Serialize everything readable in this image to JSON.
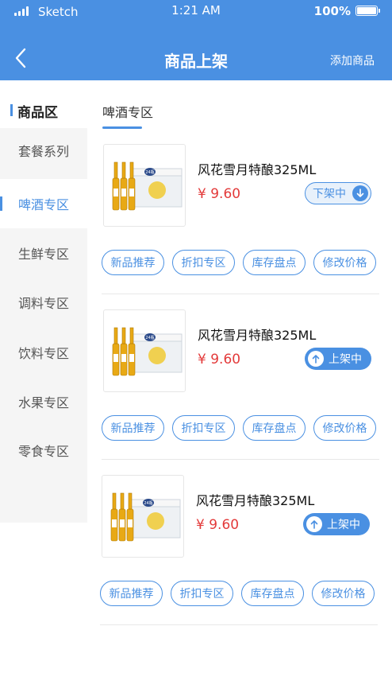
{
  "status_bar": {
    "carrier": "Sketch",
    "time": "1:21 AM",
    "battery": "100%",
    "signal_icon": "signal-icon",
    "battery_icon": "battery-icon"
  },
  "nav": {
    "title": "商品上架",
    "action": "添加商品",
    "back_icon": "chevron-left-icon"
  },
  "colors": {
    "primary": "#4a90e2",
    "price": "#e33a3a",
    "sidebar_bg": "#f5f5f5"
  },
  "sidebar": {
    "header": "商品区",
    "items": [
      {
        "label": "套餐系列",
        "active": false
      },
      {
        "label": "啤酒专区",
        "active": true
      },
      {
        "label": "生鲜专区",
        "active": false
      },
      {
        "label": "调料专区",
        "active": false
      },
      {
        "label": "饮料专区",
        "active": false
      },
      {
        "label": "水果专区",
        "active": false
      },
      {
        "label": "零食专区",
        "active": false
      }
    ]
  },
  "content": {
    "tab": "啤酒专区",
    "products": [
      {
        "name": "风花雪月特酿325ML",
        "price": "¥ 9.60",
        "status_label": "下架中",
        "status_icon": "arrow-down-circle-icon",
        "listed": false,
        "image_badge": "24瓶",
        "actions": [
          "新品推荐",
          "折扣专区",
          "库存盘点",
          "修改价格"
        ]
      },
      {
        "name": "风花雪月特酿325ML",
        "price": "¥ 9.60",
        "status_label": "上架中",
        "status_icon": "arrow-up-circle-icon",
        "listed": true,
        "image_badge": "24瓶",
        "actions": [
          "新品推荐",
          "折扣专区",
          "库存盘点",
          "修改价格"
        ]
      },
      {
        "name": "风花雪月特酿325ML",
        "price": "¥ 9.60",
        "status_label": "上架中",
        "status_icon": "arrow-up-circle-icon",
        "listed": true,
        "image_badge": "24瓶",
        "actions": [
          "新品推荐",
          "折扣专区",
          "库存盘点",
          "修改价格"
        ]
      }
    ]
  }
}
